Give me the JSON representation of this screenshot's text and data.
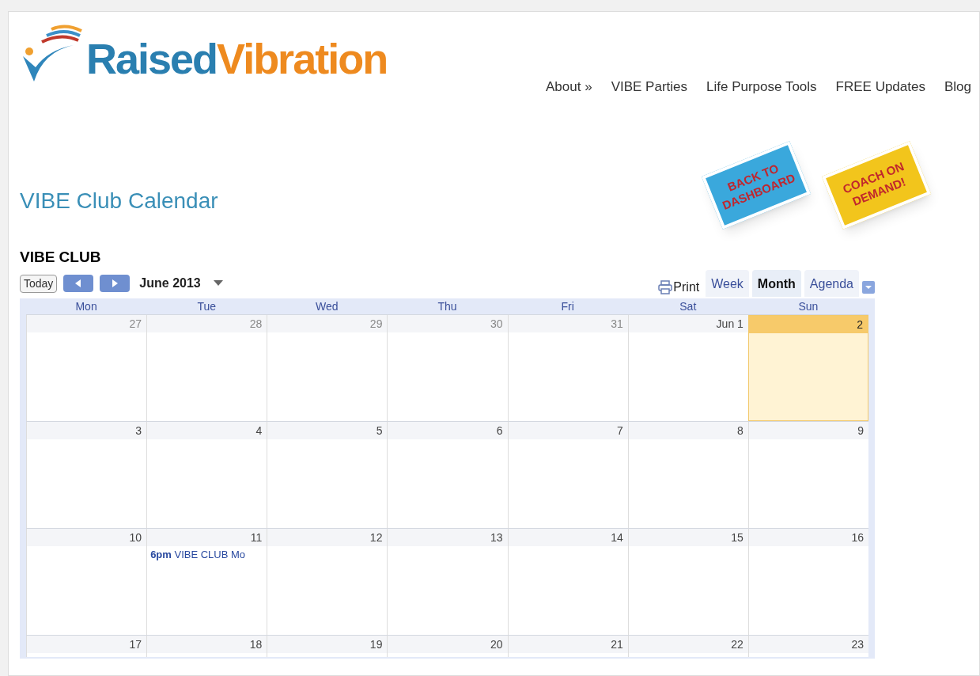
{
  "logo": {
    "part_1": "Raised",
    "part_2": "Vibration"
  },
  "nav": [
    {
      "label": "About »"
    },
    {
      "label": "VIBE Parties"
    },
    {
      "label": "Life Purpose Tools"
    },
    {
      "label": "FREE Updates"
    },
    {
      "label": "Blog"
    }
  ],
  "page_title": "VIBE Club Calendar",
  "stickers": [
    {
      "kind": "blue",
      "line_1": "BACK TO",
      "line_2": "DASHBOARD"
    },
    {
      "kind": "yellow",
      "line_1": "COACH ON",
      "line_2": "DEMAND!"
    }
  ],
  "calendar": {
    "name": "VIBE CLUB",
    "today_button": "Today",
    "month": "June 2013",
    "print": "Print",
    "views": [
      {
        "label": "Week",
        "selected": false
      },
      {
        "label": "Month",
        "selected": true
      },
      {
        "label": "Agenda",
        "selected": false
      }
    ],
    "weekdays": [
      "Mon",
      "Tue",
      "Wed",
      "Thu",
      "Fri",
      "Sat",
      "Sun"
    ],
    "weeks": [
      [
        {
          "day": "27",
          "other_month": true,
          "today": false
        },
        {
          "day": "28",
          "other_month": true,
          "today": false
        },
        {
          "day": "29",
          "other_month": true,
          "today": false
        },
        {
          "day": "30",
          "other_month": true,
          "today": false
        },
        {
          "day": "31",
          "other_month": true,
          "today": false
        },
        {
          "day": "Jun 1",
          "other_month": false,
          "today": false
        },
        {
          "day": "2",
          "other_month": false,
          "today": true
        }
      ],
      [
        {
          "day": "3",
          "other_month": false,
          "today": false
        },
        {
          "day": "4",
          "other_month": false,
          "today": false
        },
        {
          "day": "5",
          "other_month": false,
          "today": false
        },
        {
          "day": "6",
          "other_month": false,
          "today": false
        },
        {
          "day": "7",
          "other_month": false,
          "today": false
        },
        {
          "day": "8",
          "other_month": false,
          "today": false
        },
        {
          "day": "9",
          "other_month": false,
          "today": false
        }
      ],
      [
        {
          "day": "10",
          "other_month": false,
          "today": false
        },
        {
          "day": "11",
          "other_month": false,
          "today": false,
          "events": [
            "**6pm** VIBE CLUB Mo"
          ]
        },
        {
          "day": "12",
          "other_month": false,
          "today": false
        },
        {
          "day": "13",
          "other_month": false,
          "today": false
        },
        {
          "day": "14",
          "other_month": false,
          "today": false
        },
        {
          "day": "15",
          "other_month": false,
          "today": false
        },
        {
          "day": "16",
          "other_month": false,
          "today": false
        }
      ],
      [
        {
          "day": "17",
          "other_month": false,
          "today": false
        },
        {
          "day": "18",
          "other_month": false,
          "today": false
        },
        {
          "day": "19",
          "other_month": false,
          "today": false
        },
        {
          "day": "20",
          "other_month": false,
          "today": false
        },
        {
          "day": "21",
          "other_month": false,
          "today": false
        },
        {
          "day": "22",
          "other_month": false,
          "today": false
        },
        {
          "day": "23",
          "other_month": false,
          "today": false
        }
      ]
    ]
  }
}
